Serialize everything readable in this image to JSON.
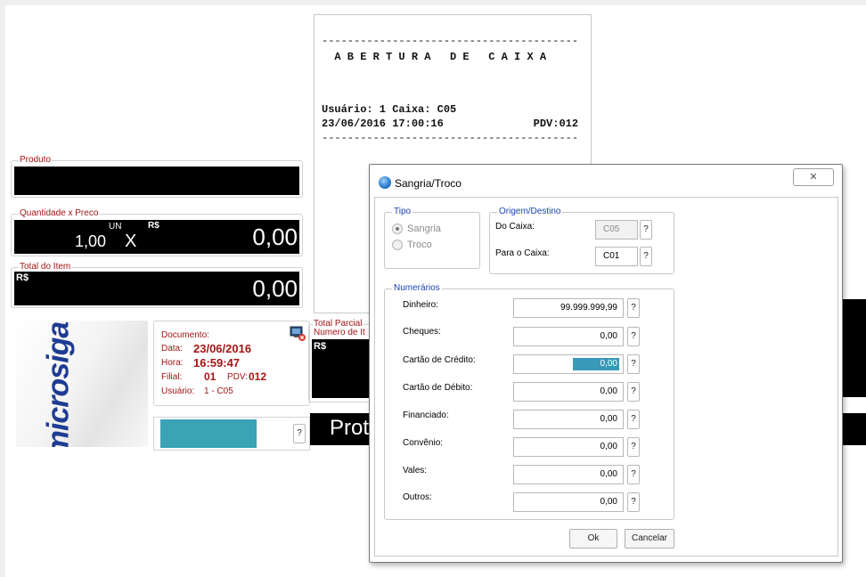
{
  "receipt": {
    "lines": [
      "----------------------------------------",
      "  A B E R T U R A   D E   C A I X A",
      "",
      "",
      "Usuário: 1 Caixa: C05",
      "23/06/2016 17:00:16              PDV:012",
      "----------------------------------------"
    ]
  },
  "produto": {
    "legend": "Produto",
    "value": ""
  },
  "quantidade": {
    "legend": "Quantidade x Preco",
    "qty": "1,00",
    "unit": "UN",
    "times": "X",
    "currency": "R$",
    "price": "0,00"
  },
  "total_item": {
    "legend": "Total do Item",
    "currency": "R$",
    "value": "0,00"
  },
  "total_parcial": {
    "legend": "Total Parcial",
    "legend2": "Numero de It",
    "currency": "R$"
  },
  "protocol_text": "Prot",
  "logo": {
    "text": "microsiga"
  },
  "info": {
    "documento_label": "Documento:",
    "data_label": "Data:",
    "data_value": "23/06/2016",
    "hora_label": "Hora:",
    "hora_value": "16:59:47",
    "filial_label": "Filial:",
    "filial_value": "01",
    "pdv_label": "PDV:",
    "pdv_value": "012",
    "usuario_label": "Usuário:",
    "usuario_value": "1 - C05"
  },
  "progress": {
    "fraction": 0.74,
    "help": "?"
  },
  "dialog": {
    "title": "Sangria/Troco",
    "close": "✕",
    "tipo": {
      "legend": "Tipo",
      "options": [
        "Sangria",
        "Troco"
      ],
      "selected": "Sangria"
    },
    "origem": {
      "legend": "Origem/Destino",
      "do_caixa_label": "Do Caixa:",
      "do_caixa_value": "C05",
      "para_caixa_label": "Para o Caixa:",
      "para_caixa_value": "C01"
    },
    "numerarios": {
      "legend": "Numerários",
      "rows": [
        {
          "label": "Dinheiro:",
          "value": "99.999.999,99"
        },
        {
          "label": "Cheques:",
          "value": "0,00"
        },
        {
          "label": "Cartão de Crédito:",
          "value": "0,00"
        },
        {
          "label": "Cartão de Débito:",
          "value": "0,00"
        },
        {
          "label": "Financiado:",
          "value": "0,00"
        },
        {
          "label": "Convênio:",
          "value": "0,00"
        },
        {
          "label": "Vales:",
          "value": "0,00"
        },
        {
          "label": "Outros:",
          "value": "0,00"
        }
      ]
    },
    "ok_label": "Ok",
    "cancel_label": "Cancelar",
    "help": "?"
  }
}
